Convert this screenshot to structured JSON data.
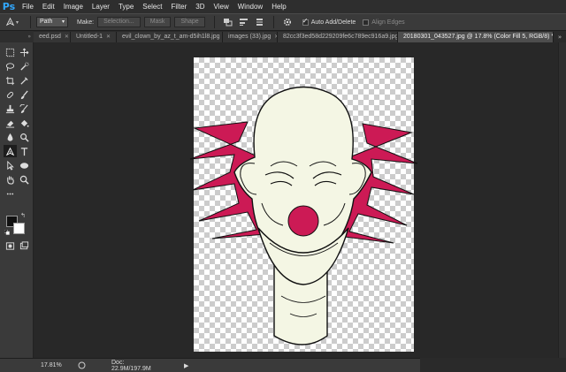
{
  "app": {
    "logo": "Ps"
  },
  "menu": [
    "File",
    "Edit",
    "Image",
    "Layer",
    "Type",
    "Select",
    "Filter",
    "3D",
    "View",
    "Window",
    "Help"
  ],
  "options": {
    "mode_value": "Path",
    "make_label": "Make:",
    "buttons": [
      "Selection...",
      "Mask",
      "Shape"
    ],
    "auto_add_delete": "Auto Add/Delete",
    "align_edges": "Align Edges"
  },
  "tabs": [
    {
      "label": "eed.psd",
      "active": false
    },
    {
      "label": "Untitled-1",
      "active": false
    },
    {
      "label": "evil_clown_by_az_t_am-d5ih1l8.jpg",
      "active": false
    },
    {
      "label": "images (33).jpg",
      "active": false
    },
    {
      "label": "82cc3f3ed58d229209fe6c789ec916a9.jpg",
      "active": false
    },
    {
      "label": "20180301_043527.jpg @ 17.8% (Color Fill 5, RGB/8) *",
      "active": true
    }
  ],
  "tabs_more": "»",
  "status": {
    "zoom": "17.81%",
    "doc": "Doc: 22.9M/197.9M",
    "arrow": "▶"
  },
  "colors": {
    "clown_red": "#cc1a55",
    "face": "#f4f6e4",
    "outline": "#111111",
    "accent_blue": "#31a8ff"
  },
  "toolbar_icons": [
    "move-icon",
    "marquee-icon",
    "lasso-icon",
    "quick-selection-icon",
    "crop-icon",
    "eyedropper-icon",
    "healing-brush-icon",
    "brush-icon",
    "clone-stamp-icon",
    "history-brush-icon",
    "eraser-icon",
    "paint-bucket-icon",
    "blur-icon",
    "dodge-icon",
    "pen-icon",
    "type-icon",
    "path-selection-icon",
    "ellipse-icon",
    "hand-icon",
    "zoom-icon"
  ]
}
